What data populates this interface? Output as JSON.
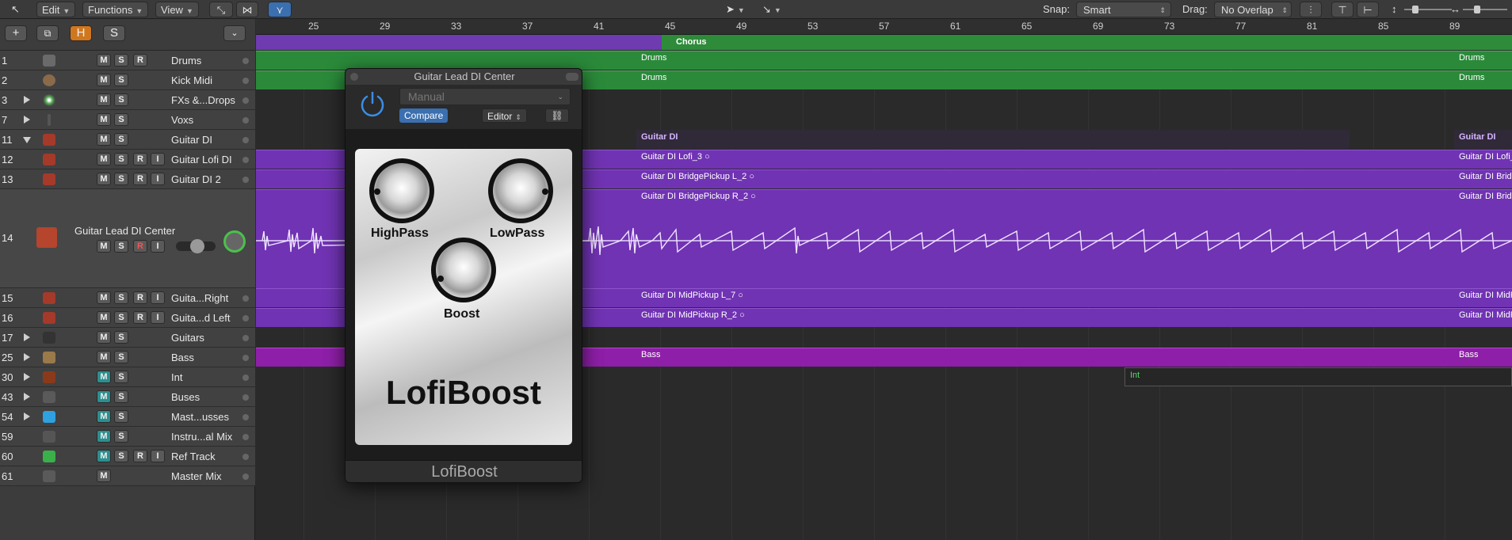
{
  "toolbar": {
    "menus": [
      "Edit",
      "Functions",
      "View"
    ],
    "snap_label": "Snap:",
    "snap_value": "Smart",
    "drag_label": "Drag:",
    "drag_value": "No Overlap"
  },
  "header_tools": {
    "add": "+",
    "h": "H",
    "s": "S"
  },
  "ruler": {
    "bars": [
      "25",
      "29",
      "33",
      "37",
      "41",
      "45",
      "49",
      "53",
      "57",
      "61",
      "65",
      "69",
      "73",
      "77",
      "81",
      "85",
      "89"
    ]
  },
  "markers": {
    "chorus": "Chorus"
  },
  "tracks": [
    {
      "num": "1",
      "name": "Drums"
    },
    {
      "num": "2",
      "name": "Kick Midi"
    },
    {
      "num": "3",
      "name": "FXs &...Drops"
    },
    {
      "num": "7",
      "name": "Voxs"
    },
    {
      "num": "11",
      "name": "Guitar DI"
    },
    {
      "num": "12",
      "name": "Guitar Lofi DI"
    },
    {
      "num": "13",
      "name": "Guitar DI 2"
    },
    {
      "num": "14",
      "name": "Guitar Lead DI Center"
    },
    {
      "num": "15",
      "name": "Guita...Right"
    },
    {
      "num": "16",
      "name": "Guita...d Left"
    },
    {
      "num": "17",
      "name": "Guitars"
    },
    {
      "num": "25",
      "name": "Bass"
    },
    {
      "num": "30",
      "name": "Int"
    },
    {
      "num": "43",
      "name": "Buses"
    },
    {
      "num": "54",
      "name": "Mast...usses"
    },
    {
      "num": "59",
      "name": "Instru...al Mix"
    },
    {
      "num": "60",
      "name": "Ref Track"
    },
    {
      "num": "61",
      "name": "Master Mix"
    }
  ],
  "button_labels": {
    "mute": "M",
    "solo": "S",
    "record": "R",
    "input": "I"
  },
  "regions": {
    "drums": "Drums",
    "guitar_di": "Guitar DI",
    "lofi": "Guitar DI Lofi_3",
    "lofi_right": "Guitar DI Lofi_",
    "bridge_l": "Guitar DI BridgePickup L_2",
    "bridge_r": "Guitar DI BridgePickup R_2",
    "bridge_cut": "Guitar DI Bridg",
    "mid_l": "Guitar DI MidPickup L_7",
    "mid_r": "Guitar DI MidPickup R_2",
    "mid_cut": "Guitar DI MidP",
    "bass": "Bass",
    "int": "Int"
  },
  "plugin": {
    "title": "Guitar Lead DI Center",
    "preset": "Manual",
    "compare": "Compare",
    "editor": "Editor",
    "knobs": {
      "highpass": "HighPass",
      "lowpass": "LowPass",
      "boost": "Boost"
    },
    "brand": "LofiBoost",
    "footer": "LofiBoost"
  },
  "colors": {
    "green": "#2a8a3a",
    "purple": "#7033b3",
    "magenta": "#8e1fa8",
    "accent_blue": "#3a6fb0"
  }
}
